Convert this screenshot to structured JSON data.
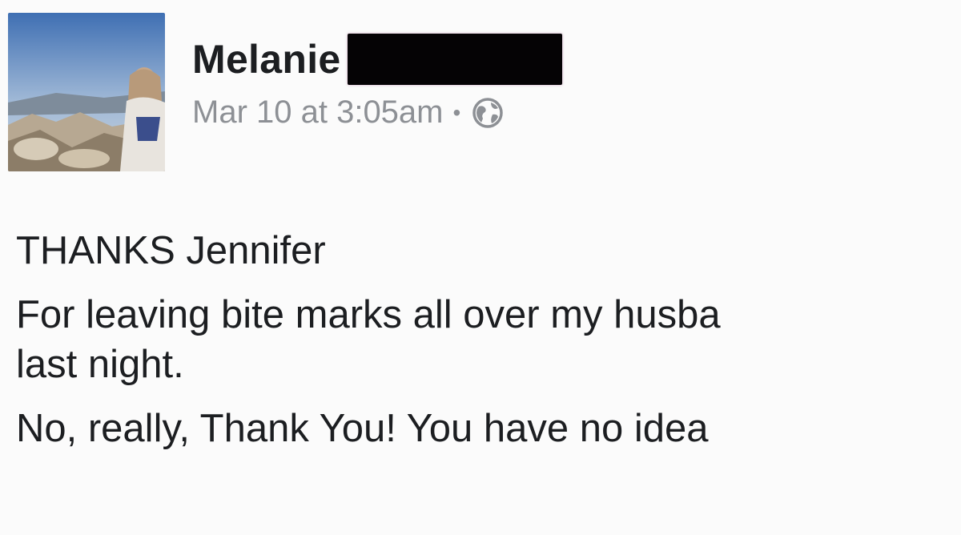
{
  "post": {
    "author": {
      "name": "Melanie",
      "name_redacted": true
    },
    "meta": {
      "timestamp": "Mar 10 at 3:05am",
      "separator": "•",
      "privacy_icon": "globe-icon"
    },
    "body": {
      "line1": "THANKS Jennifer",
      "line2": "For leaving bite marks all over my husba",
      "line3": "last night.",
      "line4": "No, really, Thank You! You have no idea"
    }
  },
  "colors": {
    "background": "#fbfbfb",
    "text": "#1c1e21",
    "meta_text": "#8d9095",
    "redaction": "#050305"
  }
}
